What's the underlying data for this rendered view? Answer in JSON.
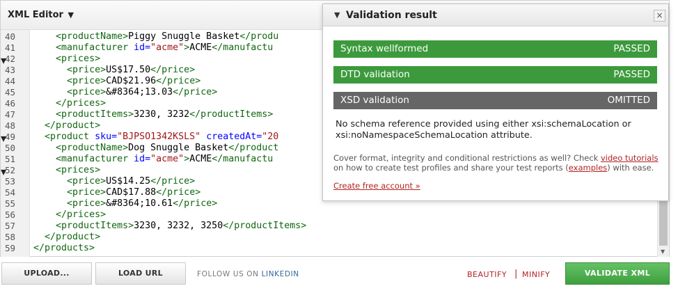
{
  "editor": {
    "title": "XML Editor",
    "title_caret": "▼",
    "lines": [
      {
        "num": "40",
        "fold": "",
        "parts": [
          [
            "t",
            "    "
          ],
          [
            "g",
            "<productName>"
          ],
          [
            "t",
            "Piggy Snuggle Basket"
          ],
          [
            "g",
            "</produ"
          ]
        ]
      },
      {
        "num": "41",
        "fold": "",
        "parts": [
          [
            "t",
            "    "
          ],
          [
            "g",
            "<manufacturer "
          ],
          [
            "a",
            "id="
          ],
          [
            "v",
            "\"acme\""
          ],
          [
            "g",
            ">"
          ],
          [
            "t",
            "ACME"
          ],
          [
            "g",
            "</manufactu"
          ]
        ]
      },
      {
        "num": "42",
        "fold": "▾",
        "parts": [
          [
            "t",
            "    "
          ],
          [
            "g",
            "<prices>"
          ]
        ]
      },
      {
        "num": "43",
        "fold": "",
        "parts": [
          [
            "t",
            "      "
          ],
          [
            "g",
            "<price>"
          ],
          [
            "t",
            "US$17.50"
          ],
          [
            "g",
            "</price>"
          ]
        ]
      },
      {
        "num": "44",
        "fold": "",
        "parts": [
          [
            "t",
            "      "
          ],
          [
            "g",
            "<price>"
          ],
          [
            "t",
            "CAD$21.96"
          ],
          [
            "g",
            "</price>"
          ]
        ]
      },
      {
        "num": "45",
        "fold": "",
        "parts": [
          [
            "t",
            "      "
          ],
          [
            "g",
            "<price>"
          ],
          [
            "t",
            "&#8364;13.03"
          ],
          [
            "g",
            "</price>"
          ]
        ]
      },
      {
        "num": "46",
        "fold": "",
        "parts": [
          [
            "t",
            "    "
          ],
          [
            "g",
            "</prices>"
          ]
        ]
      },
      {
        "num": "47",
        "fold": "",
        "parts": [
          [
            "t",
            "    "
          ],
          [
            "g",
            "<productItems>"
          ],
          [
            "t",
            "3230, 3232"
          ],
          [
            "g",
            "</productItems>"
          ]
        ]
      },
      {
        "num": "48",
        "fold": "",
        "parts": [
          [
            "t",
            "  "
          ],
          [
            "g",
            "</product>"
          ]
        ]
      },
      {
        "num": "49",
        "fold": "▾",
        "parts": [
          [
            "t",
            "  "
          ],
          [
            "g",
            "<product "
          ],
          [
            "a",
            "sku="
          ],
          [
            "v",
            "\"BJPSO1342KSLS\""
          ],
          [
            "t",
            " "
          ],
          [
            "a",
            "createdAt="
          ],
          [
            "v",
            "\"20"
          ]
        ]
      },
      {
        "num": "50",
        "fold": "",
        "parts": [
          [
            "t",
            "    "
          ],
          [
            "g",
            "<productName>"
          ],
          [
            "t",
            "Dog Snuggle Basket"
          ],
          [
            "g",
            "</product"
          ]
        ]
      },
      {
        "num": "51",
        "fold": "",
        "parts": [
          [
            "t",
            "    "
          ],
          [
            "g",
            "<manufacturer "
          ],
          [
            "a",
            "id="
          ],
          [
            "v",
            "\"acme\""
          ],
          [
            "g",
            ">"
          ],
          [
            "t",
            "ACME"
          ],
          [
            "g",
            "</manufactu"
          ]
        ]
      },
      {
        "num": "52",
        "fold": "▾",
        "parts": [
          [
            "t",
            "    "
          ],
          [
            "g",
            "<prices>"
          ]
        ]
      },
      {
        "num": "53",
        "fold": "",
        "parts": [
          [
            "t",
            "      "
          ],
          [
            "g",
            "<price>"
          ],
          [
            "t",
            "US$14.25"
          ],
          [
            "g",
            "</price>"
          ]
        ]
      },
      {
        "num": "54",
        "fold": "",
        "parts": [
          [
            "t",
            "      "
          ],
          [
            "g",
            "<price>"
          ],
          [
            "t",
            "CAD$17.88"
          ],
          [
            "g",
            "</price>"
          ]
        ]
      },
      {
        "num": "55",
        "fold": "",
        "parts": [
          [
            "t",
            "      "
          ],
          [
            "g",
            "<price>"
          ],
          [
            "t",
            "&#8364;10.61"
          ],
          [
            "g",
            "</price>"
          ]
        ]
      },
      {
        "num": "56",
        "fold": "",
        "parts": [
          [
            "t",
            "    "
          ],
          [
            "g",
            "</prices>"
          ]
        ]
      },
      {
        "num": "57",
        "fold": "",
        "parts": [
          [
            "t",
            "    "
          ],
          [
            "g",
            "<productItems>"
          ],
          [
            "t",
            "3230, 3232, 3250"
          ],
          [
            "g",
            "</productItems>"
          ]
        ]
      },
      {
        "num": "58",
        "fold": "",
        "parts": [
          [
            "t",
            "  "
          ],
          [
            "g",
            "</product>"
          ]
        ]
      },
      {
        "num": "59",
        "fold": "",
        "parts": [
          [
            "g",
            "</products>"
          ]
        ]
      }
    ]
  },
  "validation": {
    "toggle_icon": "▼",
    "title": "Validation result",
    "close_icon": "×",
    "results": [
      {
        "label": "Syntax wellformed",
        "status": "PASSED",
        "kind": "pass"
      },
      {
        "label": "DTD validation",
        "status": "PASSED",
        "kind": "pass"
      },
      {
        "label": "XSD validation",
        "status": "OMITTED",
        "kind": "omit"
      }
    ],
    "note": "No schema reference provided using either xsi:schemaLocation or xsi:noNamespaceSchemaLocation attribute.",
    "info_part1": "Cover format, integrity and conditional restrictions as well? Check ",
    "info_link1": "video tutorials",
    "info_part2": " on how to create test profiles and share your test reports (",
    "info_link2": "examples",
    "info_part3": ") with ease.",
    "cta": "Create free account »"
  },
  "toolbar": {
    "upload_label": "UPLOAD...",
    "load_url_label": "LOAD URL",
    "follow_text": "FOLLOW US ON ",
    "follow_link": "LINKEDIN",
    "beautify_label": "BEAUTIFY",
    "separator": "|",
    "minify_label": "MINIFY",
    "validate_label": "VALIDATE XML"
  },
  "colors": {
    "pass": "#3c9a3c",
    "omit": "#666666",
    "validate_button": "#4caf50",
    "link_red": "#b22222",
    "xml_tag": "#116611",
    "xml_attr": "#0000ff",
    "xml_value": "#a31515"
  }
}
